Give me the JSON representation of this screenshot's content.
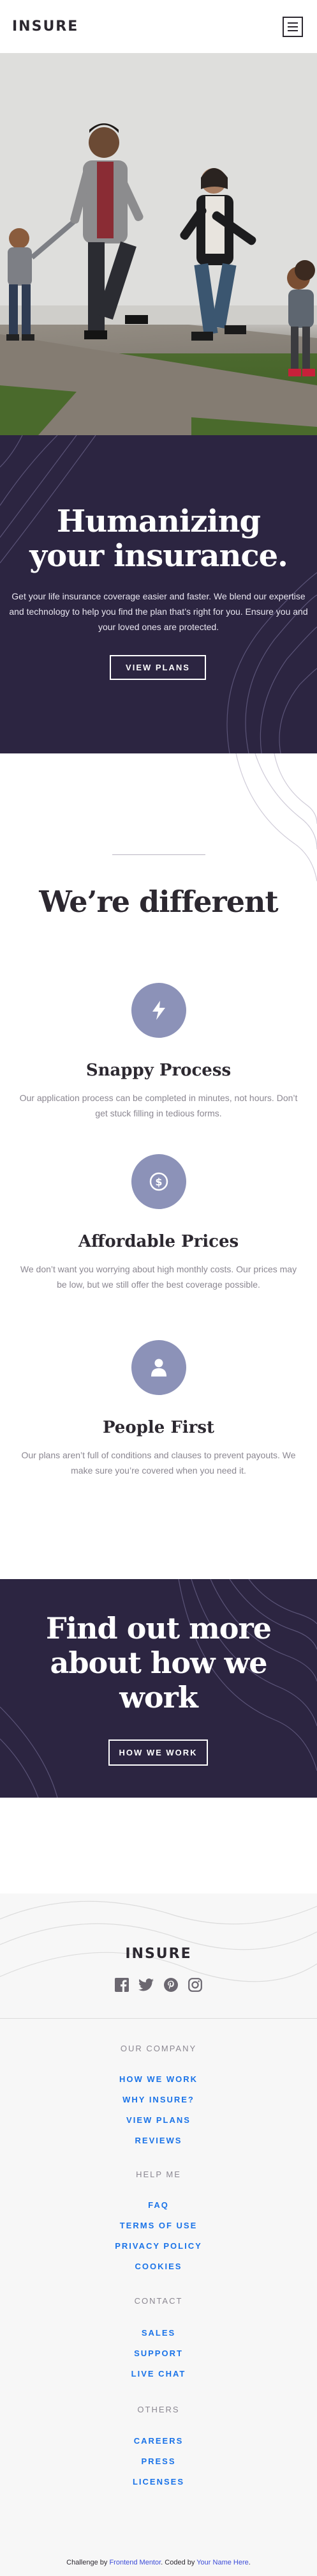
{
  "header": {
    "logo": "INSURE",
    "menu_icon": "hamburger-icon"
  },
  "hero": {
    "title_line1": "Humanizing",
    "title_line2": "your insurance.",
    "description": "Get your life insurance coverage easier and faster. We blend our expertise and technology to help you find the plan that’s right for you. Ensure you and your loved ones are protected.",
    "button_label": "VIEW PLANS"
  },
  "different": {
    "title": "We’re different",
    "features": [
      {
        "icon": "lightning-icon",
        "title": "Snappy Process",
        "text": "Our application process can be completed in minutes, not hours. Don’t get stuck filling in tedious forms."
      },
      {
        "icon": "dollar-icon",
        "title": "Affordable Prices",
        "text": "We don’t want you worrying about high monthly costs. Our prices may be low, but we still offer the best coverage possible."
      },
      {
        "icon": "person-icon",
        "title": "People First",
        "text": "Our plans aren’t full of conditions and clauses to prevent payouts. We make sure you’re covered when you need it."
      }
    ]
  },
  "more": {
    "title_line1": "Find out more",
    "title_line2": "about how we",
    "title_line3": "work",
    "button_label": "HOW WE WORK"
  },
  "footer": {
    "logo": "INSURE",
    "socials": [
      "facebook-icon",
      "twitter-icon",
      "pinterest-icon",
      "instagram-icon"
    ],
    "groups": [
      {
        "heading": "OUR COMPANY",
        "links": [
          "HOW WE WORK",
          "WHY INSURE?",
          "VIEW PLANS",
          "REVIEWS"
        ]
      },
      {
        "heading": "HELP ME",
        "links": [
          "FAQ",
          "TERMS OF USE",
          "PRIVACY POLICY",
          "COOKIES"
        ]
      },
      {
        "heading": "CONTACT",
        "links": [
          "SALES",
          "SUPPORT",
          "LIVE CHAT"
        ]
      },
      {
        "heading": "OTHERS",
        "links": [
          "CAREERS",
          "PRESS",
          "LICENSES"
        ]
      }
    ]
  },
  "attribution": {
    "prefix": "Challenge by",
    "mentor": "Frontend Mentor",
    "middle": ". Coded by",
    "author": "Your Name Here",
    "suffix": "."
  },
  "colors": {
    "dark_violet": "#2c2541",
    "grayish_violet": "#8c92b8",
    "link_blue": "#1a73e8"
  }
}
